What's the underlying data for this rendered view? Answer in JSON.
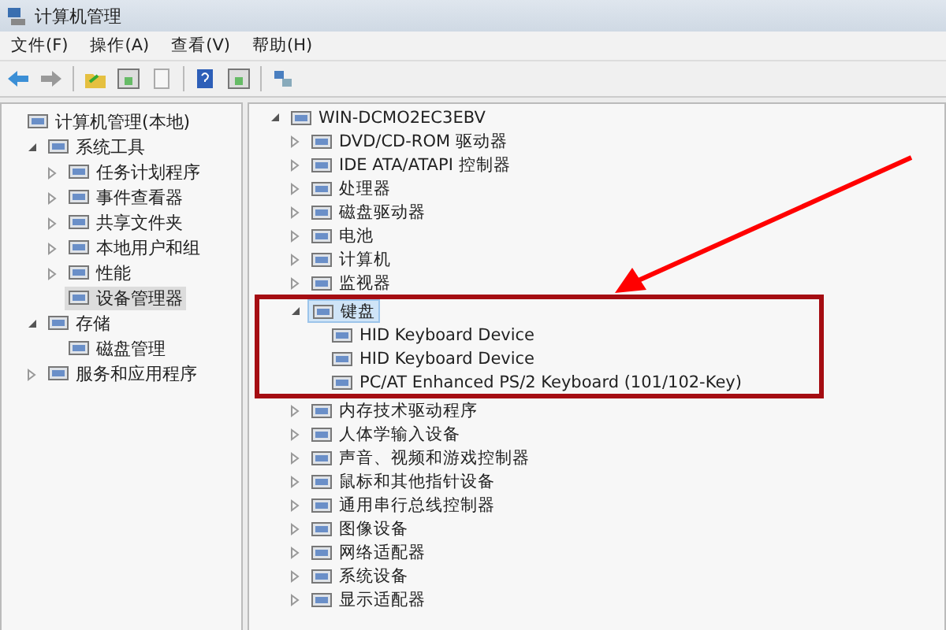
{
  "window": {
    "title": "计算机管理"
  },
  "menu": [
    "文件(F)",
    "操作(A)",
    "查看(V)",
    "帮助(H)"
  ],
  "left_tree": [
    {
      "label": "计算机管理(本地)",
      "selected": false,
      "children": [
        {
          "label": "系统工具",
          "expanded": true,
          "selected": false,
          "children": [
            {
              "label": "任务计划程序",
              "expanded": false,
              "selected": false
            },
            {
              "label": "事件查看器",
              "expanded": false,
              "selected": false
            },
            {
              "label": "共享文件夹",
              "expanded": false,
              "selected": false
            },
            {
              "label": "本地用户和组",
              "expanded": false,
              "selected": false
            },
            {
              "label": "性能",
              "expanded": false,
              "selected": false
            },
            {
              "label": "设备管理器",
              "selected": true
            }
          ]
        },
        {
          "label": "存储",
          "expanded": true,
          "selected": false,
          "children": [
            {
              "label": "磁盘管理",
              "selected": false
            }
          ]
        },
        {
          "label": "服务和应用程序",
          "expanded": false,
          "selected": false
        }
      ]
    }
  ],
  "device_tree": [
    {
      "label": "WIN-DCMO2EC3EBV",
      "expanded": true,
      "selected": false,
      "children": [
        {
          "label": "DVD/CD-ROM 驱动器",
          "expanded": false,
          "selected": false
        },
        {
          "label": "IDE ATA/ATAPI 控制器",
          "expanded": false,
          "selected": false
        },
        {
          "label": "处理器",
          "expanded": false,
          "selected": false
        },
        {
          "label": "磁盘驱动器",
          "expanded": false,
          "selected": false
        },
        {
          "label": "电池",
          "expanded": false,
          "selected": false
        },
        {
          "label": "计算机",
          "expanded": false,
          "selected": false
        },
        {
          "label": "监视器",
          "expanded": false,
          "selected": false
        },
        {
          "label": "键盘",
          "expanded": true,
          "selected": true,
          "children": [
            {
              "label": "HID Keyboard Device",
              "selected": false
            },
            {
              "label": "HID Keyboard Device",
              "selected": false
            },
            {
              "label": "PC/AT Enhanced PS/2 Keyboard (101/102-Key)",
              "selected": false
            }
          ]
        },
        {
          "label": "内存技术驱动程序",
          "expanded": false,
          "selected": false
        },
        {
          "label": "人体学输入设备",
          "expanded": false,
          "selected": false
        },
        {
          "label": "声音、视频和游戏控制器",
          "expanded": false,
          "selected": false
        },
        {
          "label": "鼠标和其他指针设备",
          "expanded": false,
          "selected": false
        },
        {
          "label": "通用串行总线控制器",
          "expanded": false,
          "selected": false
        },
        {
          "label": "图像设备",
          "expanded": false,
          "selected": false
        },
        {
          "label": "网络适配器",
          "expanded": false,
          "selected": false
        },
        {
          "label": "系统设备",
          "expanded": false,
          "selected": false
        },
        {
          "label": "显示适配器",
          "expanded": false,
          "selected": false
        }
      ]
    }
  ]
}
